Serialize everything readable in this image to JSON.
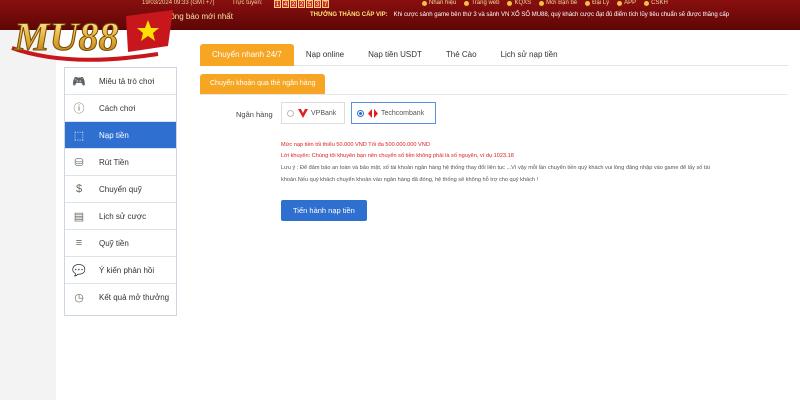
{
  "brand": {
    "logo_text": "MU88"
  },
  "topbar": {
    "datetime": "19/03/2024 09:33 (GMT+7)",
    "online_label": "Trực tuyến:",
    "online_digits": [
      "1",
      "4",
      "2",
      "2",
      "5",
      "3",
      "7"
    ],
    "notice_label": "Thông báo mới nhất",
    "links": [
      "Nhãn hiệu",
      "Trang web",
      "KQXS",
      "Mời Bạn bè",
      "Đại Lý",
      "APP",
      "CSKH"
    ],
    "vip_title": "THƯỞNG THĂNG CẤP VIP:",
    "vip_text": "Khi cược sảnh game bên thứ 3 và sảnh VN XỔ SỐ MU88, quý khách cược đạt đủ điểm tích lũy tiêu chuẩn sẽ được thăng cấp"
  },
  "sidebar": {
    "items": [
      {
        "label": "Miêu tả trò chơi",
        "icon": "gamepad-icon"
      },
      {
        "label": "Cách chơi",
        "icon": "info-icon"
      },
      {
        "label": "Nạp tiền",
        "icon": "deposit-icon",
        "active": true
      },
      {
        "label": "Rút Tiền",
        "icon": "withdraw-icon"
      },
      {
        "label": "Chuyển quỹ",
        "icon": "transfer-icon"
      },
      {
        "label": "Lịch sử cược",
        "icon": "history-icon"
      },
      {
        "label": "Quỹ tiền",
        "icon": "coins-icon"
      },
      {
        "label": "Ý kiến phản hồi",
        "icon": "chat-icon"
      },
      {
        "label": "Kết quả mở thưởng",
        "icon": "clock-icon"
      }
    ]
  },
  "tabs": [
    {
      "label": "Chuyển nhanh 24/7",
      "active": true
    },
    {
      "label": "Nạp online"
    },
    {
      "label": "Nạp tiền USDT"
    },
    {
      "label": "Thẻ Cào"
    },
    {
      "label": "Lịch sử nạp tiền"
    }
  ],
  "subtab": "Chuyển khoản qua thẻ ngân hàng",
  "bank": {
    "label": "Ngân hàng",
    "options": [
      {
        "name": "VPBank",
        "selected": false
      },
      {
        "name": "Techcombank",
        "selected": true
      }
    ]
  },
  "messages": {
    "limit": "Mức nạp tiền tối thiểu 50.000 VND Tối đa 500.000.000 VND",
    "advice": "Lời khuyên: Chúng tôi khuyên bạn nên chuyển số tiền không phải là số nguyên, ví dụ 1023.18",
    "note_line1": "Lưu ý : Để đảm bảo an toàn và bảo mật, số tài khoản ngân hàng hệ thống thay đổi liên tục ...Vì vậy mỗi lần chuyển tiền quý khách vui lòng đăng nhập vào game để lấy số tài",
    "note_line2": "khoản.Nếu quý khách chuyển khoản vào ngân hàng đã đóng, hệ thống sẽ không hỗ trợ cho quý khách !"
  },
  "submit_label": "Tiến hành nạp tiền",
  "colors": {
    "accent_orange": "#f6a623",
    "primary_blue": "#2f6fd0",
    "topbar_red": "#8a0f0f",
    "warning_red": "#dd2222"
  }
}
